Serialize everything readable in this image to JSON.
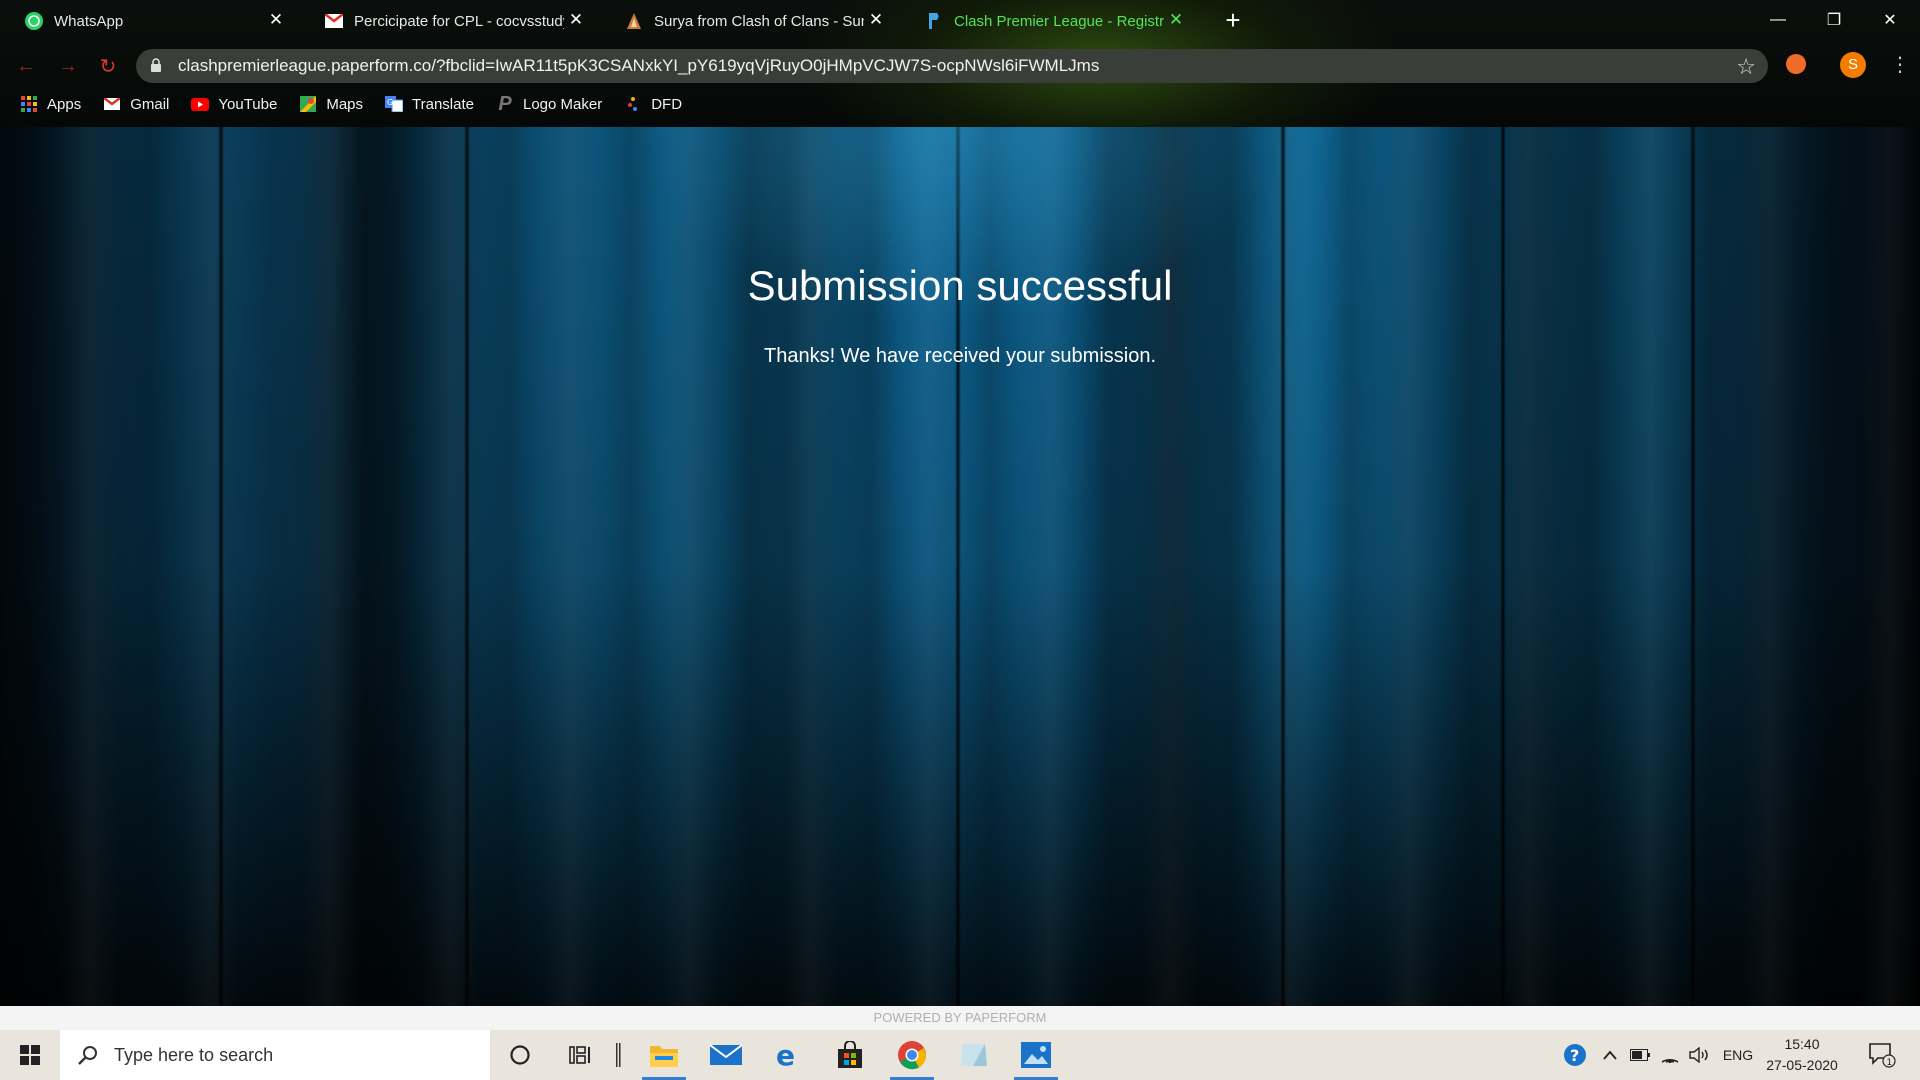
{
  "browser": {
    "tabs": [
      {
        "title": "WhatsApp",
        "icon": "whatsapp-icon",
        "active": false
      },
      {
        "title": "Percicipate for CPL - cocvsstudy@",
        "icon": "gmail-icon",
        "active": false
      },
      {
        "title": "Surya from Clash of Clans - Sum",
        "icon": "clash-icon",
        "active": false
      },
      {
        "title": "Clash Premier League - Registrati",
        "icon": "paperform-icon",
        "active": true
      }
    ],
    "new_tab_label": "+",
    "window_controls": {
      "minimize": "—",
      "restore": "❐",
      "close": "✕"
    },
    "url": "clashpremierleague.paperform.co/?fbclid=IwAR11t5pK3CSANxkYI_pY619yqVjRuyO0jHMpVCJW7S-ocpNWsl6iFWMLJms",
    "profile_initial": "S",
    "bookmarks": [
      {
        "label": "Apps",
        "icon": "apps-grid-icon"
      },
      {
        "label": "Gmail",
        "icon": "gmail-icon"
      },
      {
        "label": "YouTube",
        "icon": "youtube-icon"
      },
      {
        "label": "Maps",
        "icon": "maps-icon"
      },
      {
        "label": "Translate",
        "icon": "translate-icon"
      },
      {
        "label": "Logo Maker",
        "icon": "logo-maker-icon"
      },
      {
        "label": "DFD",
        "icon": "dfd-icon"
      }
    ]
  },
  "page": {
    "heading": "Submission successful",
    "message": "Thanks! We have received your submission.",
    "powered_by": "POWERED BY PAPERFORM"
  },
  "taskbar": {
    "search_placeholder": "Type here to search",
    "language": "ENG",
    "time": "15:40",
    "date": "27-05-2020",
    "notification_count": "1"
  },
  "colors": {
    "active_tab_text": "#54e35a",
    "page_background": "#0a4a6c",
    "taskbar": "#e9e4dc",
    "taskbar_running_indicator": "#2f7fd7"
  }
}
